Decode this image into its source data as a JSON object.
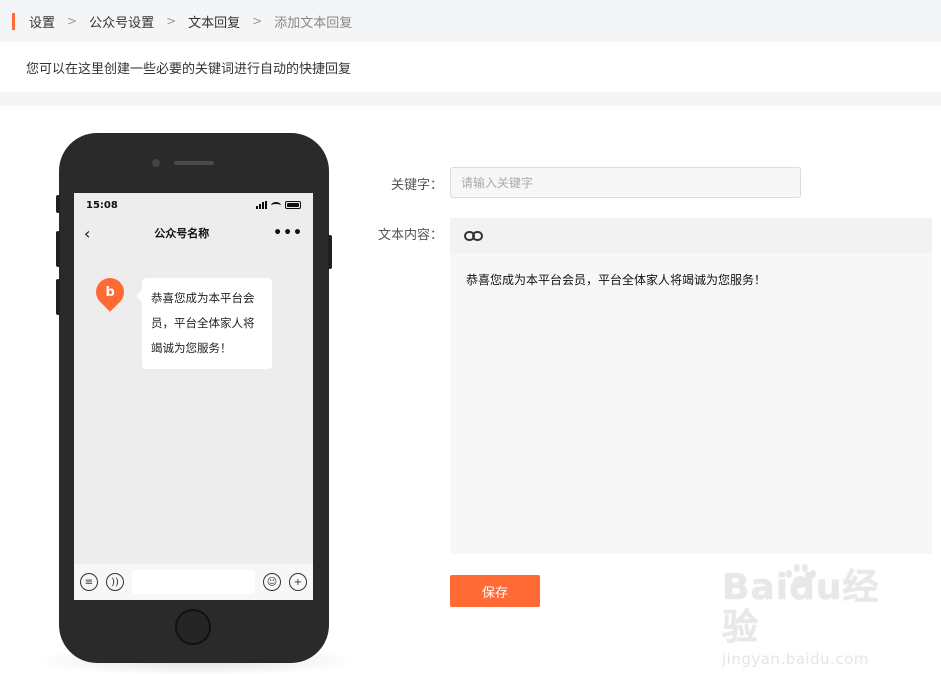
{
  "breadcrumb": {
    "items": [
      "设置",
      "公众号设置",
      "文本回复"
    ],
    "current": "添加文本回复",
    "separator": ">"
  },
  "notice": "您可以在这里创建一些必要的关键词进行自动的快捷回复",
  "phone": {
    "time": "15:08",
    "chat_title": "公众号名称",
    "avatar_glyph": "b",
    "message": "恭喜您成为本平台会员，平台全体家人将竭诚为您服务！"
  },
  "form": {
    "keyword_label": "关键字：",
    "keyword_placeholder": "请输入关键字",
    "keyword_value": "",
    "content_label": "文本内容：",
    "content_text": "恭喜您成为本平台会员，平台全体家人将竭诚为您服务！",
    "save_label": "保存"
  },
  "watermark": {
    "logo": "Baidu经验",
    "url": "jingyan.baidu.com"
  },
  "colors": {
    "accent": "#ff6a35",
    "phone_body": "#2a2a2a",
    "page_bg": "#f4f5f7"
  },
  "icons": [
    "link-icon",
    "back-icon",
    "more-icon",
    "voice-icon",
    "menu-icon",
    "emoji-icon",
    "plus-icon"
  ]
}
